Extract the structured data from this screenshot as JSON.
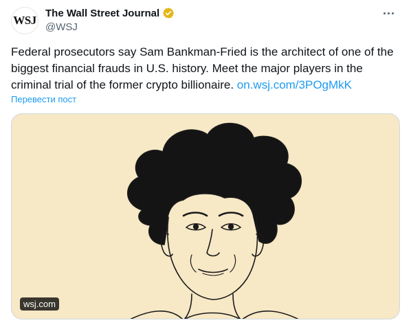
{
  "tweet": {
    "author": {
      "avatar_text": "WSJ",
      "display_name": "The Wall Street Journal",
      "handle": "@WSJ",
      "verified_icon": "verified-gold-badge-icon"
    },
    "more_icon": "more-horizontal-icon",
    "text": "Federal prosecutors say Sam Bankman-Fried is the architect of one of the biggest financial frauds in U.S. history. Meet the major players in the criminal trial of the former crypto billionaire. ",
    "link_text": "on.wsj.com/3POgMkK",
    "translate_label": "Перевести пост",
    "media": {
      "description_icon": "portrait-illustration",
      "source_badge": "wsj.com"
    }
  },
  "colors": {
    "text": "#0f1419",
    "secondary": "#536471",
    "link": "#1d9bf0",
    "verified_gold": "#e2b719",
    "media_background": "#f7e8c6"
  }
}
